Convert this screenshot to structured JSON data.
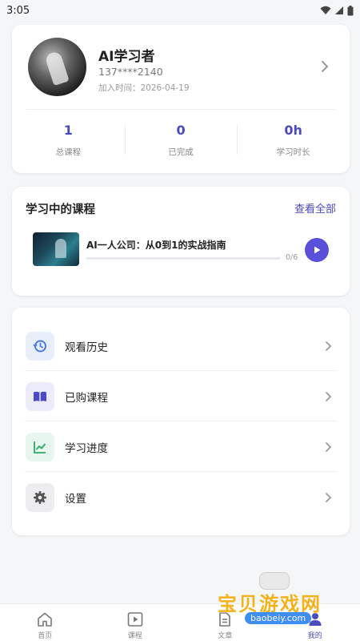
{
  "status_bar": {
    "time": "3:05"
  },
  "profile": {
    "name": "AI学习者",
    "phone": "137****2140",
    "joined": "加入时间：2026-04-19",
    "stats": [
      {
        "value": "1",
        "label": "总课程"
      },
      {
        "value": "0",
        "label": "已完成"
      },
      {
        "value": "0h",
        "label": "学习时长"
      }
    ]
  },
  "learning": {
    "title": "学习中的课程",
    "view_all": "查看全部",
    "course": {
      "title": "AI一人公司：从0到1的实战指南",
      "progress_text": "0/6",
      "progress": 0.0
    }
  },
  "menu": [
    {
      "label": "观看历史",
      "icon": "history-icon"
    },
    {
      "label": "已购课程",
      "icon": "book-icon"
    },
    {
      "label": "学习进度",
      "icon": "trend-chart-icon"
    },
    {
      "label": "设置",
      "icon": "gear-icon"
    }
  ],
  "tabbar": {
    "tabs": [
      {
        "label": "首页",
        "icon": "home-icon"
      },
      {
        "label": "课程",
        "icon": "play-square-icon"
      },
      {
        "label": "文章",
        "icon": "document-icon"
      },
      {
        "label": "我的",
        "icon": "user-icon"
      }
    ],
    "active": 3
  },
  "watermark": {
    "title": "宝贝游戏网",
    "url": "baobeiy.com"
  },
  "colors": {
    "accent": "#4a4abf",
    "play": "#5a4fd8",
    "history_bg": "#e8effa",
    "book_bg": "#ecebf9",
    "progress_bg": "#e7f6ee",
    "settings_bg": "#ededf0"
  }
}
